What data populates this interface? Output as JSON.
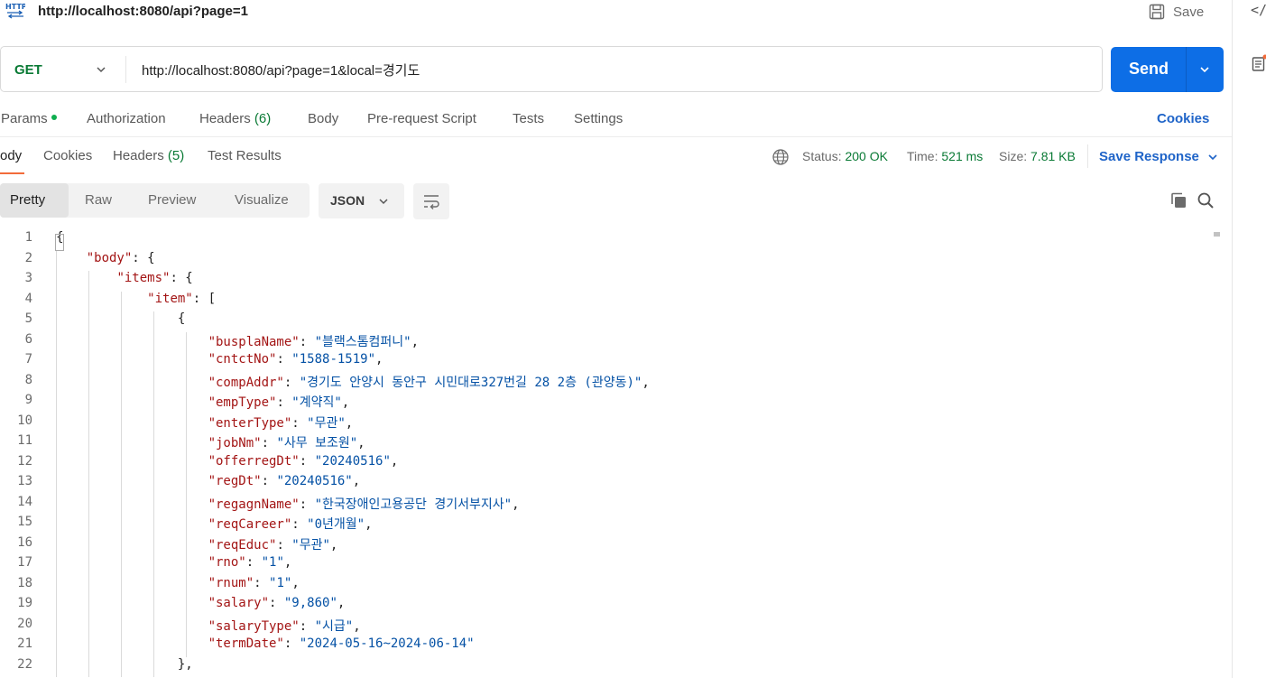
{
  "title": {
    "icon": "http-icon",
    "text": "http://localhost:8080/api?page=1",
    "save_label": "Save"
  },
  "request": {
    "method": "GET",
    "url": "http://localhost:8080/api?page=1&local=경기도",
    "send_label": "Send"
  },
  "request_tabs": {
    "params": "Params",
    "authorization": "Authorization",
    "headers": "Headers",
    "headers_count": "(6)",
    "body": "Body",
    "prerequest": "Pre-request Script",
    "tests": "Tests",
    "settings": "Settings",
    "cookies": "Cookies"
  },
  "response_tabs": {
    "body": "ody",
    "cookies": "Cookies",
    "headers": "Headers",
    "headers_count": "(5)",
    "test_results": "Test Results"
  },
  "status": {
    "status_label": "Status:",
    "status_value": "200 OK",
    "time_label": "Time:",
    "time_value": "521 ms",
    "size_label": "Size:",
    "size_value": "7.81 KB",
    "save_response": "Save Response"
  },
  "format": {
    "pretty": "Pretty",
    "raw": "Raw",
    "preview": "Preview",
    "visualize": "Visualize",
    "language": "JSON"
  },
  "code_lines": [
    "{",
    "    \"body\": {",
    "        \"items\": {",
    "            \"item\": [",
    "                {",
    "                    \"busplaName\": \"블랙스톰컴퍼니\",",
    "                    \"cntctNo\": \"1588-1519\",",
    "                    \"compAddr\": \"경기도 안양시 동안구 시민대로327번길 28 2층 (관양동)\",",
    "                    \"empType\": \"계약직\",",
    "                    \"enterType\": \"무관\",",
    "                    \"jobNm\": \"사무 보조원\",",
    "                    \"offerregDt\": \"20240516\",",
    "                    \"regDt\": \"20240516\",",
    "                    \"regagnName\": \"한국장애인고용공단 경기서부지사\",",
    "                    \"reqCareer\": \"0년개월\",",
    "                    \"reqEduc\": \"무관\",",
    "                    \"rno\": \"1\",",
    "                    \"rnum\": \"1\",",
    "                    \"salary\": \"9,860\",",
    "                    \"salaryType\": \"시급\",",
    "                    \"termDate\": \"2024-05-16~2024-06-14\"",
    "                },"
  ]
}
